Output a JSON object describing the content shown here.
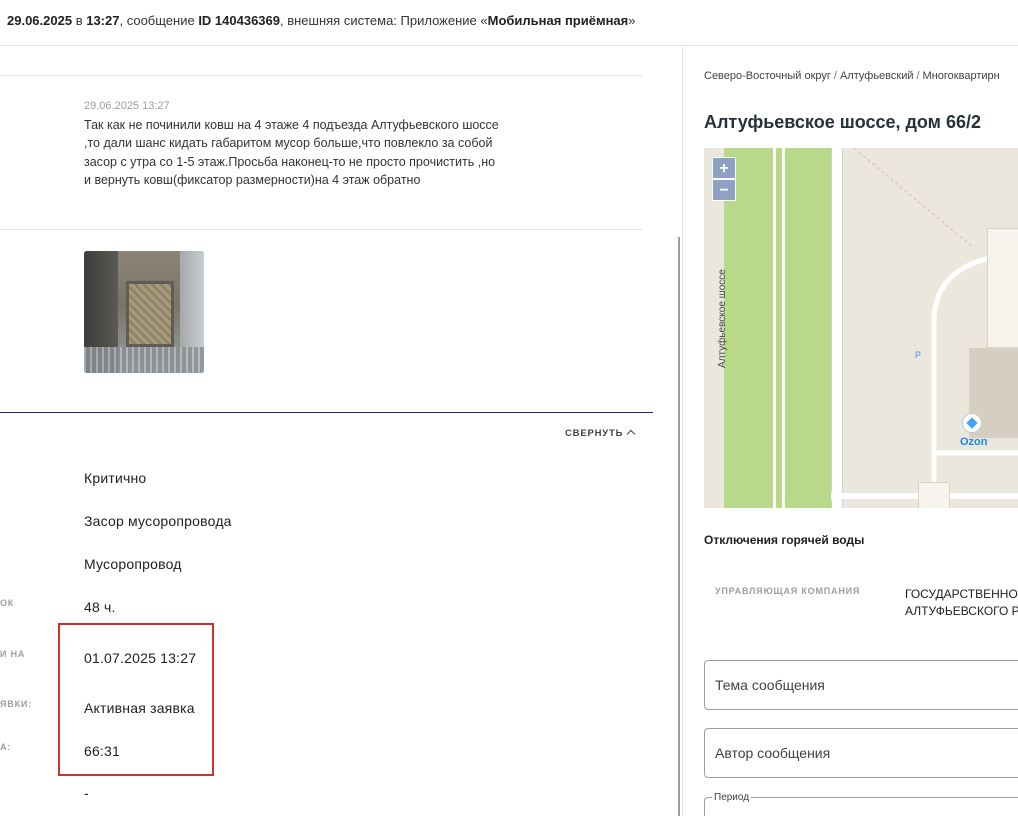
{
  "header": {
    "date": "29.06.2025",
    "in_word": " в ",
    "time": "13:27",
    "message_prefix": ", сообщение ",
    "message_id": "ID 140436369",
    "system_prefix": ", внешняя система: Приложение «",
    "system_name": "Мобильная приёмная",
    "system_suffix": "»"
  },
  "message": {
    "date": "29.06.2025 13:27",
    "text": "Так как не починили ковш на 4 этаже 4 подъезда Алтуфьевского шоссе ,то дали шанс кидать габаритом мусор больше,что повлекло за собой засор с утра со 1-5 этаж.Просьба наконец-то не просто прочистить ,но и вернуть ковш(фиксатор размерности)на 4 этаж обратно"
  },
  "details": {
    "collapse_label": "СВЕРНУТЬ",
    "fields": [
      {
        "label": "",
        "value": "Критично"
      },
      {
        "label": "",
        "value": "Засор мусоропровода"
      },
      {
        "label": "",
        "value": "Мусоропровод"
      },
      {
        "label": "ОК",
        "value": "48 ч."
      },
      {
        "label": "И НА",
        "value": "01.07.2025 13:27"
      },
      {
        "label": "ЯВКИ:",
        "value": "Активная заявка"
      },
      {
        "label": "А:",
        "value": "66:31"
      },
      {
        "label": "",
        "value": "-"
      }
    ]
  },
  "breadcrumb": {
    "items": [
      "Северо-Восточный округ",
      "Алтуфьевский",
      "Многоквартирн"
    ],
    "separator": "/"
  },
  "address": "Алтуфьевское шоссе, дом 66/2",
  "map": {
    "zoom_in": "+",
    "zoom_out": "−",
    "street_label": "Алтуфьевское шоссе",
    "poi_label": "Ozon",
    "parking_label": "P"
  },
  "hot_water": {
    "title": "Отключения горячей воды",
    "company_label": "УПРАВЛЯЮЩАЯ КОМПАНИЯ",
    "company_value_line1": "ГОСУДАРСТВЕННО",
    "company_value_line2": "АЛТУФЬЕВСКОГО Р"
  },
  "form": {
    "subject_placeholder": "Тема сообщения",
    "author_placeholder": "Автор сообщения",
    "period_label": "Период"
  },
  "colors": {
    "highlight": "#d32f2f",
    "divider": "#1a237e",
    "map_green": "#b9d98a",
    "poi_blue": "#1e88e5"
  }
}
